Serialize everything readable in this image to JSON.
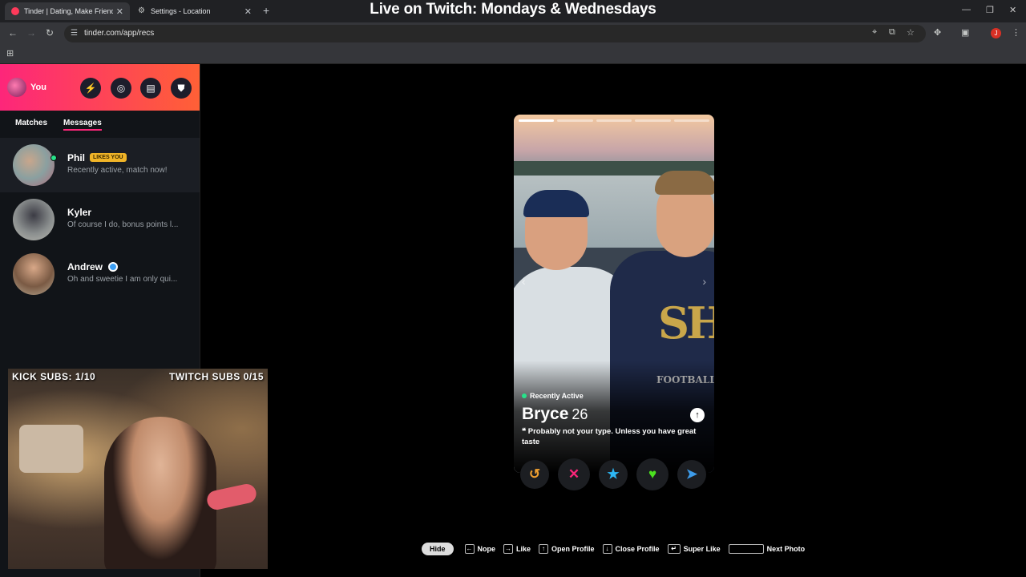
{
  "browser": {
    "tabs": [
      {
        "title": "Tinder | Dating, Make Friends &",
        "active": true,
        "favicon_color": "#fd3a5a"
      },
      {
        "title": "Settings - Location",
        "active": false
      }
    ],
    "url": "tinder.com/app/recs",
    "banner": "Live on Twitch: Mondays & Wednesdays"
  },
  "sidebar": {
    "user_label": "You",
    "tabs": [
      "Matches",
      "Messages"
    ],
    "messages": [
      {
        "name": "Phil",
        "badge": "LIKES YOU",
        "preview": "Recently active, match now!"
      },
      {
        "name": "Kyler",
        "preview": "Of course I do, bonus points l..."
      },
      {
        "name": "Andrew",
        "preview": "Oh and sweetie I am only qui..."
      }
    ]
  },
  "stream": {
    "kick_subs": "KICK SUBS: 1/10",
    "twitch_subs": "TWITCH SUBS 0/15"
  },
  "card": {
    "status": "Recently Active",
    "name": "Bryce",
    "age": "26",
    "bio": "Probably not your type. Unless you have great taste",
    "photo_count": 5,
    "current_photo": 1
  },
  "actions": [
    {
      "icon": "rewind-icon",
      "color": "#f0a030"
    },
    {
      "icon": "nope-icon",
      "color": "#fd267a"
    },
    {
      "icon": "super-like-icon",
      "color": "#2db7f5"
    },
    {
      "icon": "like-icon",
      "color": "#4be21f"
    },
    {
      "icon": "boost-icon",
      "color": "#3d9be9"
    }
  ],
  "shortcuts": {
    "hide": "Hide",
    "nope": "Nope",
    "like": "Like",
    "open_profile": "Open Profile",
    "close_profile": "Close Profile",
    "super_like": "Super Like",
    "next_photo": "Next Photo"
  }
}
